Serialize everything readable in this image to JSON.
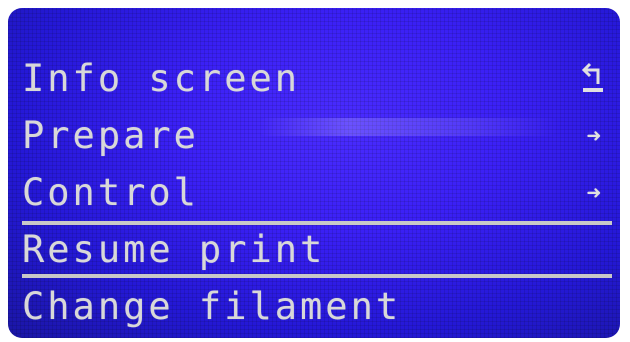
{
  "menu": {
    "items": [
      {
        "label": "Info screen",
        "icon": "back-arrow-icon",
        "arrow": ""
      },
      {
        "label": "Prepare",
        "icon": "right-arrow-icon",
        "arrow": "➜"
      },
      {
        "label": "Control",
        "icon": "right-arrow-icon",
        "arrow": "➜"
      },
      {
        "label": "Resume print",
        "icon": "",
        "arrow": "",
        "selected": true
      },
      {
        "label": "Change filament",
        "icon": "",
        "arrow": ""
      }
    ]
  },
  "colors": {
    "screen_background": "#3b20f6",
    "text": "#d8d8d8",
    "selection_lines": "#c8c8c8"
  }
}
